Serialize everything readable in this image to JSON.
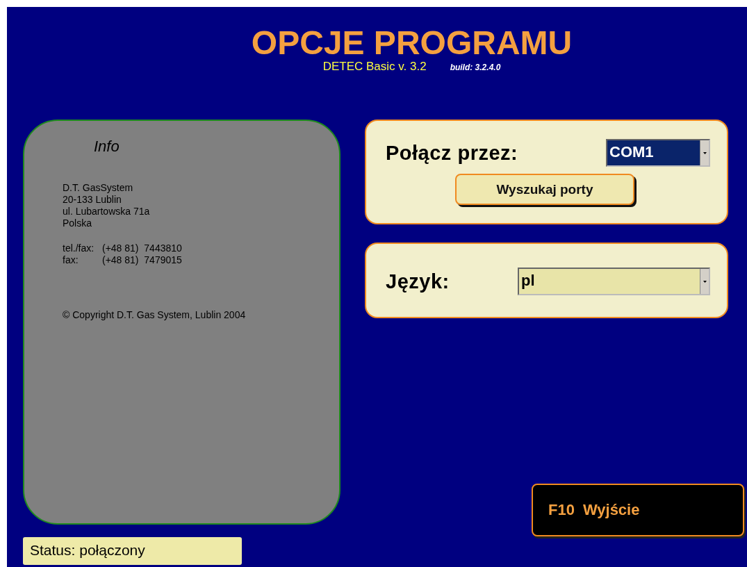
{
  "title": "OPCJE PROGRAMU",
  "subtitle": "DETEC Basic v. 3.2",
  "build": "build: 3.2.4.0",
  "info": {
    "heading": "Info",
    "address": [
      "D.T. GasSystem",
      "20-133 Lublin",
      "ul. Lubartowska 71a",
      "Polska"
    ],
    "phones": [
      {
        "label": "tel./fax:",
        "number": "(+48 81)  7443810"
      },
      {
        "label": "fax:",
        "number": "(+48 81)  7479015"
      }
    ],
    "copyright": "© Copyright D.T. Gas System, Lublin 2004"
  },
  "connection": {
    "label": "Połącz przez:",
    "port": "COM1",
    "focused": true,
    "search_button": "Wyszukaj porty"
  },
  "language": {
    "label": "Język:",
    "value": "pl",
    "focused": false
  },
  "exit_button": {
    "key": "F10",
    "label": "Wyjście"
  },
  "status": "Status: połączony"
}
